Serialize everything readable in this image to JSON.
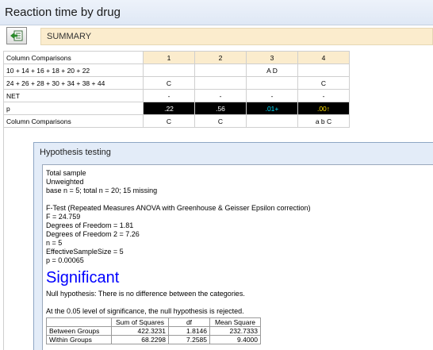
{
  "window": {
    "title": "Reaction time by drug"
  },
  "toolbar": {
    "summary_label": "SUMMARY",
    "export_icon": "export-icon"
  },
  "crosstab": {
    "header": {
      "label": "Column Comparisons",
      "columns": [
        "1",
        "2",
        "3",
        "4"
      ]
    },
    "rows": [
      {
        "label": "10 + 14 + 16 + 18 + 20 + 22",
        "cells": [
          "",
          "",
          "A D",
          ""
        ]
      },
      {
        "label": "24 + 26 + 28 + 30 + 34 + 38 + 44",
        "cells": [
          "C",
          "",
          "",
          "C"
        ]
      },
      {
        "label": "NET",
        "cells": [
          "-",
          "-",
          "-",
          "-"
        ]
      }
    ],
    "p_row": {
      "label": "p",
      "values": [
        ".22",
        ".56",
        ".01",
        ".00"
      ],
      "markers": [
        "",
        "",
        "+",
        "↑"
      ],
      "marker_colors": [
        "#ffffff",
        "#ffffff",
        "#00e0ff",
        "#ffe000"
      ]
    },
    "footer_row": {
      "label": "Column Comparisons",
      "cells": [
        "C",
        "C",
        "",
        "a b C"
      ]
    }
  },
  "dialog": {
    "title": "Hypothesis testing",
    "report": {
      "sample_lines": [
        "Total sample",
        "Unweighted",
        "base n = 5; total n = 20; 15 missing"
      ],
      "test_lines": [
        "F-Test (Repeated Measures ANOVA with Greenhouse & Geisser Epsilon correction)",
        "F = 24.759",
        "Degrees of Freedom = 1.81",
        "Degrees of Freedom 2 = 7.26",
        "n = 5",
        "EffectiveSampleSize = 5",
        "p = 0.00065"
      ],
      "result": "Significant",
      "null_hypothesis": "Null hypothesis: There is no difference between the categories.",
      "conclusion": "At the 0.05 level of significance, the null hypothesis is rejected."
    },
    "anova": {
      "headers": [
        "",
        "Sum of Squares",
        "df",
        "Mean Square"
      ],
      "rows": [
        [
          "Between Groups",
          "422.3231",
          "1.8146",
          "232.7333"
        ],
        [
          "Within Groups",
          "68.2298",
          "7.2585",
          "9.4000"
        ]
      ]
    }
  },
  "colors": {
    "summary_bg": "#fbeccd",
    "p_row_bg": "#000000",
    "significant_text": "#0000ff",
    "dialog_bg": "#e3ecf8"
  }
}
